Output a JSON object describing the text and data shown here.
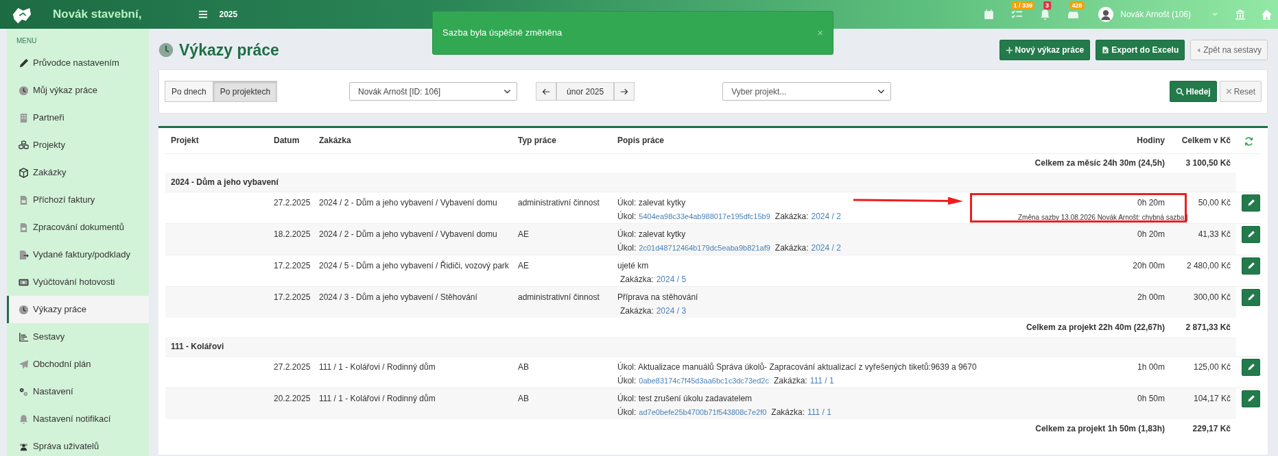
{
  "topbar": {
    "brand": "Novák stavební,",
    "year": "2025",
    "badges": [
      {
        "kind": "calendar"
      },
      {
        "kind": "tasks",
        "text": "1 / 339",
        "color": "#f0a30a"
      },
      {
        "kind": "bell",
        "text": "3",
        "color": "#dc3545"
      },
      {
        "kind": "car",
        "text": "428",
        "color": "#f0a30a"
      }
    ],
    "user": "Novák Arnošt (106)"
  },
  "toast": {
    "message": "Sazba byla úspěšně změněna",
    "close": "×"
  },
  "sidebar": {
    "heading": "MENU",
    "items": [
      {
        "label": "Průvodce nastavením",
        "selected": false
      },
      {
        "label": "Můj výkaz práce",
        "selected": false
      },
      {
        "label": "Partneři",
        "selected": false
      },
      {
        "label": "Projekty",
        "selected": false
      },
      {
        "label": "Zakázky",
        "selected": false
      },
      {
        "label": "Příchozí faktury",
        "selected": false
      },
      {
        "label": "Zpracování dokumentů",
        "selected": false
      },
      {
        "label": "Vydané faktury/podklady",
        "selected": false
      },
      {
        "label": "Vyúčtování hotovosti",
        "selected": false
      },
      {
        "label": "Výkazy práce",
        "selected": true
      },
      {
        "label": "Sestavy",
        "selected": false
      },
      {
        "label": "Obchodní plán",
        "selected": false
      },
      {
        "label": "Nastavení",
        "selected": false
      },
      {
        "label": "Nastavení notifikací",
        "selected": false
      },
      {
        "label": "Správa uživatelů",
        "selected": false
      }
    ]
  },
  "header": {
    "title": "Výkazy práce",
    "buttons": [
      {
        "label": "Nový výkaz práce",
        "kind": "new"
      },
      {
        "label": "Export do Excelu",
        "kind": "excel"
      },
      {
        "label": "Zpět na sestavy",
        "kind": "back"
      }
    ]
  },
  "filters": {
    "view": [
      {
        "label": "Po dnech",
        "selected": false
      },
      {
        "label": "Po projektech",
        "selected": true
      }
    ],
    "user": "Novák Arnošt [ID: 106]",
    "month": "únor 2025",
    "project_placeholder": "Vyber projekt...",
    "search": "Hledej",
    "reset": "Reset"
  },
  "table": {
    "columns": [
      "Projekt",
      "Datum",
      "Zakázka",
      "Typ práce",
      "Popis práce",
      "Hodiny",
      "Celkem v Kč"
    ],
    "month_total": {
      "label": "Celkem za měsíc 24h 30m (24,5h)",
      "amount": "3 100,50 Kč"
    },
    "groups": [
      {
        "name": "2024 - Dům a jeho vybavení",
        "rows": [
          {
            "date": "27.2.2025",
            "order": "2024 / 2 - Dům a jeho vybavení / Vybavení domu",
            "work_type": "administrativní činnost",
            "description": "Úkol: zalevat kytky",
            "task_label": "Úkol:",
            "task_id": "5404ea98c33e4ab988017e195dfc15b9",
            "order_label": "Zakázka:",
            "order_ref": "2024 / 2",
            "hours": "0h 20m",
            "note": "Změna sazby 13.08.2026 Novák Arnošt: chybná sazba |",
            "amount": "50,00 Kč",
            "highlighted": true
          },
          {
            "date": "18.2.2025",
            "order": "2024 / 2 - Dům a jeho vybavení / Vybavení domu",
            "work_type": "AE",
            "description": "Úkol: zalevat kytky",
            "task_label": "Úkol:",
            "task_id": "2c01d48712464b179dc5eaba9b821af9",
            "order_label": "Zakázka:",
            "order_ref": "2024 / 2",
            "hours": "0h 20m",
            "amount": "41,33 Kč",
            "highlighted": false
          },
          {
            "date": "17.2.2025",
            "order": "2024 / 5 - Dům a jeho vybavení / Řidiči, vozový park",
            "work_type": "AE",
            "description": "ujeté km",
            "order_label": "Zakázka:",
            "order_ref": "2024 / 5",
            "hours": "20h 00m",
            "amount": "2 480,00 Kč",
            "highlighted": false
          },
          {
            "date": "17.2.2025",
            "order": "2024 / 3 - Dům a jeho vybavení / Stěhování",
            "work_type": "administrativní činnost",
            "description": "Příprava na stěhování",
            "order_label": "Zakázka:",
            "order_ref": "2024 / 3",
            "hours": "2h 00m",
            "amount": "300,00 Kč",
            "highlighted": false
          }
        ],
        "total": {
          "label": "Celkem za projekt 22h 40m (22,67h)",
          "amount": "2 871,33 Kč"
        }
      },
      {
        "name": "111 - Kolářovi",
        "rows": [
          {
            "date": "27.2.2025",
            "order": "111 / 1 - Kolářovi / Rodinný dům",
            "work_type": "AB",
            "description": "Úkol: Aktualizace manuálů Správa úkolů- Zapracování aktualizací z vyřešených tiketů:9639 a 9670",
            "task_label": "Úkol:",
            "task_id": "0abe83174c7f45d3aa6bc1c3dc73ed2c",
            "order_label": "Zakázka:",
            "order_ref": "111 / 1",
            "hours": "1h 00m",
            "amount": "125,00 Kč",
            "highlighted": false
          },
          {
            "date": "20.2.2025",
            "order": "111 / 1 - Kolářovi / Rodinný dům",
            "work_type": "AB",
            "description": "Úkol: test zrušení úkolu zadavatelem",
            "task_label": "Úkol:",
            "task_id": "ad7e0befe25b4700b71f543808c7e2f0",
            "order_label": "Zakázka:",
            "order_ref": "111 / 1",
            "hours": "0h 50m",
            "amount": "104,17 Kč",
            "highlighted": false
          }
        ],
        "total": {
          "label": "Celkem za projekt 1h 50m (1,83h)",
          "amount": "229,17 Kč"
        }
      }
    ]
  }
}
